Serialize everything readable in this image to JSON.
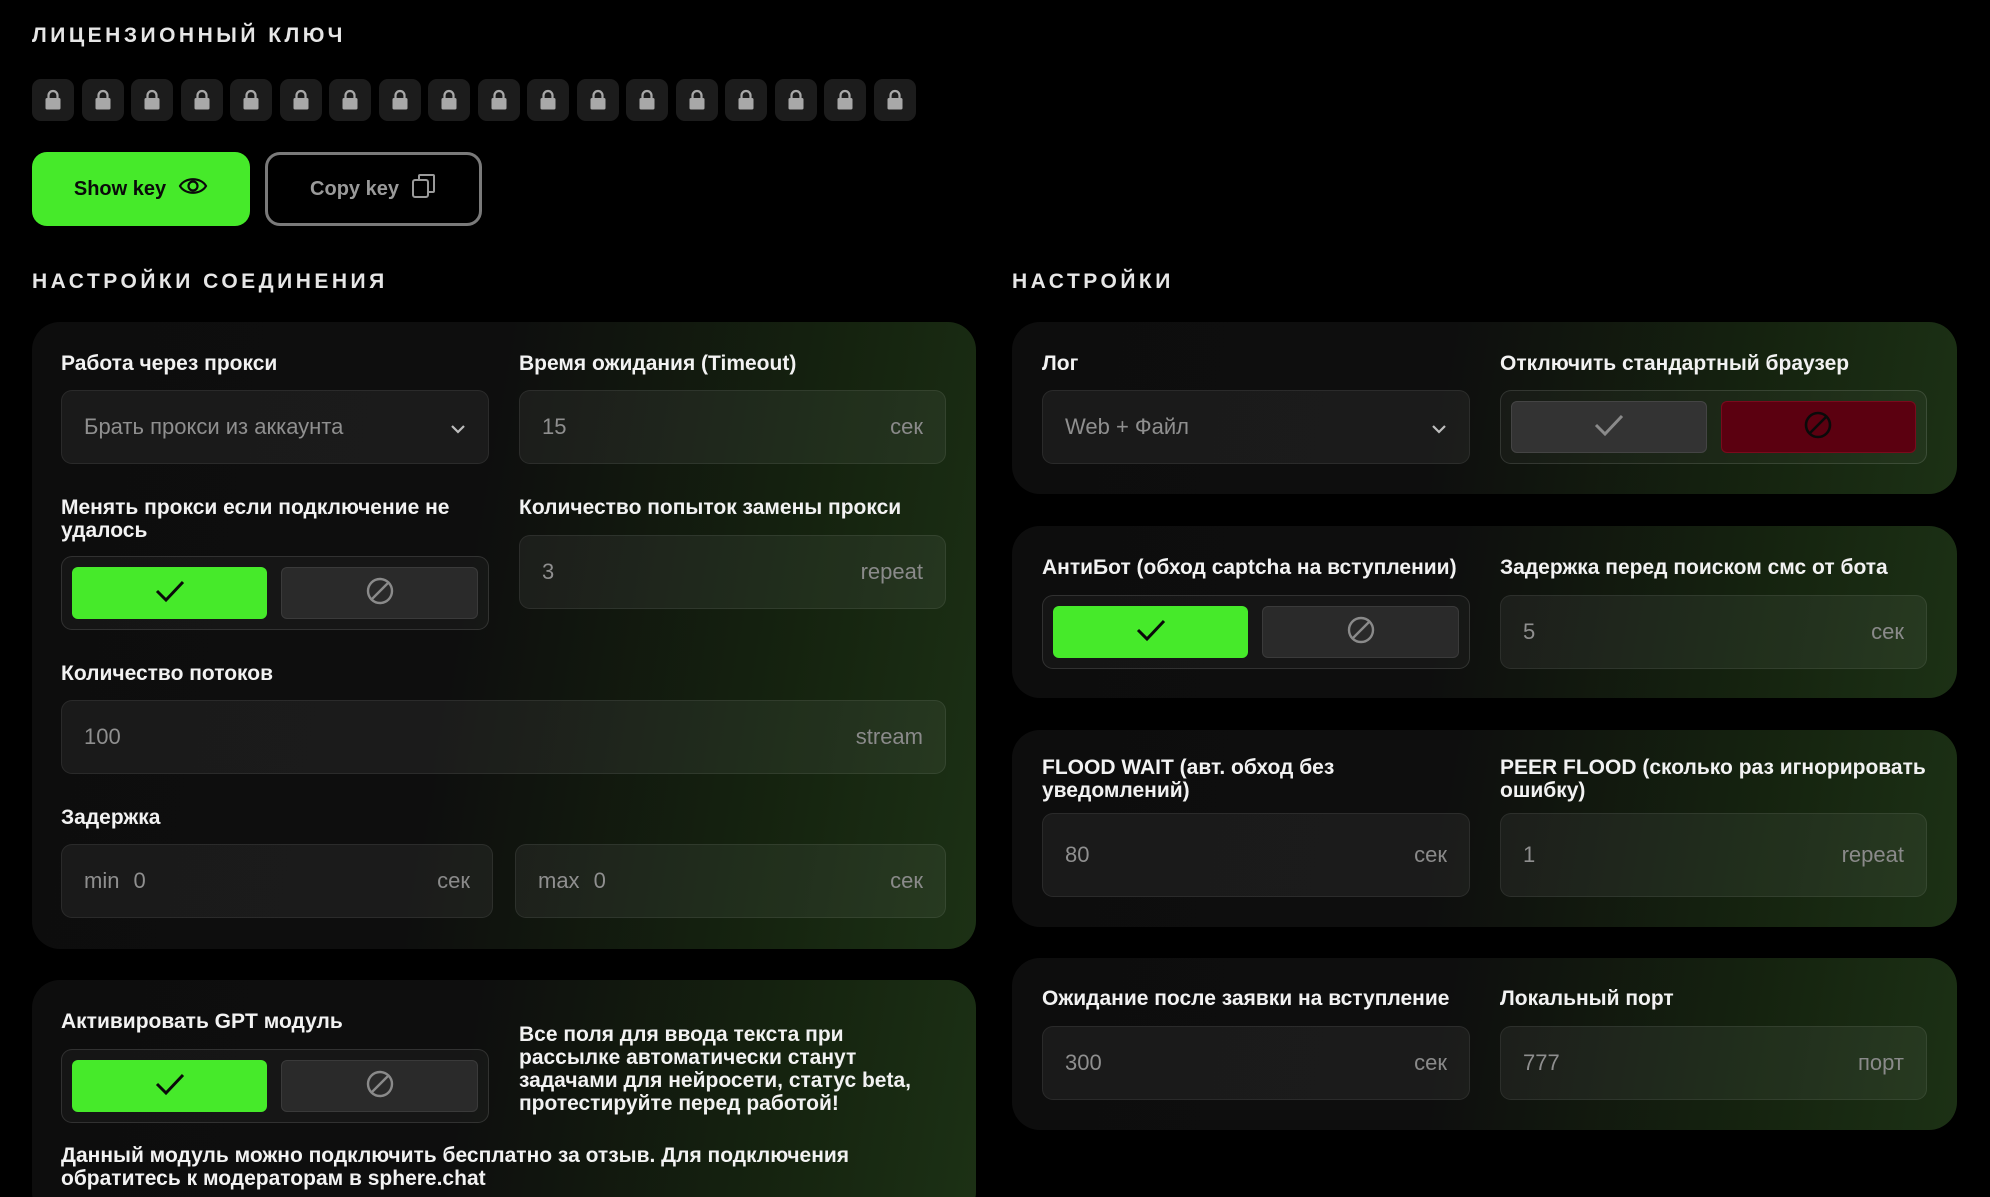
{
  "license": {
    "title": "ЛИЦЕНЗИОННЫЙ КЛЮЧ",
    "lock_count": 18,
    "show_key_label": "Show key",
    "copy_key_label": "Copy key"
  },
  "connection": {
    "title": "НАСТРОЙКИ СОЕДИНЕНИЯ",
    "proxy_label": "Работа через прокси",
    "proxy_value": "Брать прокси из аккаунта",
    "timeout_label": "Время ожидания (Timeout)",
    "timeout_value": "15",
    "timeout_unit": "сек",
    "change_proxy_label": "Менять прокси если подключение не удалось",
    "change_proxy_state": "on",
    "attempts_label": "Количество попыток замены прокси",
    "attempts_value": "3",
    "attempts_unit": "repeat",
    "threads_label": "Количество потоков",
    "threads_value": "100",
    "threads_unit": "stream",
    "delay_label": "Задержка",
    "delay_min_prefix": "min",
    "delay_min_value": "0",
    "delay_min_unit": "сек",
    "delay_max_prefix": "max",
    "delay_max_value": "0",
    "delay_max_unit": "сек"
  },
  "gpt": {
    "label": "Активировать GPT модуль",
    "state": "on",
    "info": "Все поля для ввода текста при рассылке автоматически станут задачами для нейросети, статус beta, протестируйте перед работой!",
    "footer": "Данный модуль можно подключить бесплатно за отзыв. Для подключения обратитесь к модераторам в sphere.chat"
  },
  "settings": {
    "title": "НАСТРОЙКИ",
    "log_label": "Лог",
    "log_value": "Web + Файл",
    "disable_browser_label": "Отключить стандартный браузер",
    "disable_browser_state": "off",
    "antibot_label": "АнтиБот (обход captcha на вступлении)",
    "antibot_state": "on",
    "sms_delay_label": "Задержка перед поиском смс от бота",
    "sms_delay_value": "5",
    "sms_delay_unit": "сек",
    "flood_wait_label": "FLOOD WAIT (авт. обход без уведомлений)",
    "flood_wait_value": "80",
    "flood_wait_unit": "сек",
    "peer_flood_label": "PEER FLOOD (сколько раз игнорировать ошибку)",
    "peer_flood_value": "1",
    "peer_flood_unit": "repeat",
    "join_wait_label": "Ожидание после заявки на вступление",
    "join_wait_value": "300",
    "join_wait_unit": "сек",
    "port_label": "Локальный порт",
    "port_value": "777",
    "port_unit": "порт"
  },
  "colors": {
    "accent": "#46ea2a",
    "danger": "#5b0010",
    "background": "#000000"
  }
}
